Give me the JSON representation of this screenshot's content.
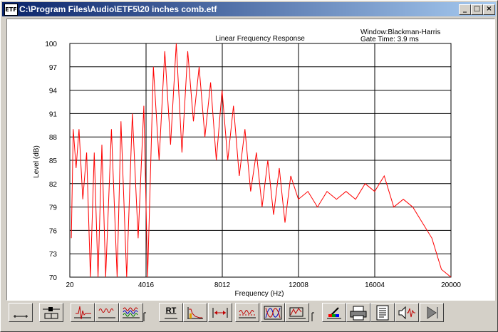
{
  "window": {
    "title": "C:\\Program Files\\Audio\\ETF5\\20 inches comb.etf",
    "app_icon": "ETF",
    "controls": {
      "minimize": "_",
      "maximize": "□",
      "close": "×"
    }
  },
  "chart": {
    "title": "Linear Frequency Response",
    "window_info": "Window:Blackman-Harris",
    "gate_info": "Gate Time: 3.9 ms",
    "xlabel": "Frequency (Hz)",
    "ylabel": "Level (dB)",
    "line_color": "#ff0000"
  },
  "chart_data": {
    "type": "line",
    "title": "Linear Frequency Response",
    "xlabel": "Frequency (Hz)",
    "ylabel": "Level (dB)",
    "xlim": [
      20,
      20000
    ],
    "ylim": [
      70,
      100
    ],
    "x_ticks": [
      "20",
      "4016",
      "8012",
      "12008",
      "16004",
      "20000"
    ],
    "y_ticks": [
      "70",
      "73",
      "76",
      "79",
      "82",
      "85",
      "88",
      "91",
      "94",
      "97",
      "100"
    ],
    "grid": true,
    "series": [
      {
        "x": [
          100,
          200,
          350,
          500,
          700,
          900,
          1100,
          1300,
          1500,
          1700,
          1900,
          2200,
          2500,
          2700,
          3000,
          3300,
          3600,
          3900,
          4100,
          4400,
          4700,
          5000,
          5300,
          5600,
          5900,
          6200,
          6500,
          6800,
          7100,
          7400,
          7700,
          8000,
          8300,
          8600,
          8900,
          9200,
          9500,
          9800,
          10100,
          10400,
          10700,
          11000,
          11300,
          11600,
          12000,
          12500,
          13000,
          13500,
          14000,
          14500,
          15000,
          15500,
          16000,
          16500,
          17000,
          17500,
          18000,
          18500,
          19000,
          19500,
          20000
        ],
        "y": [
          75,
          89,
          84,
          89,
          80,
          86,
          70,
          86,
          70,
          87,
          70,
          89,
          70,
          90,
          70,
          91,
          75,
          92,
          70,
          97,
          85,
          99,
          87,
          100,
          86,
          99,
          90,
          97,
          88,
          95,
          85,
          94,
          85,
          92,
          83,
          89,
          81,
          86,
          79,
          85,
          78,
          84,
          77,
          83,
          80,
          81,
          79,
          81,
          80,
          81,
          80,
          82,
          81,
          83,
          79,
          80,
          79,
          77,
          75,
          71,
          70
        ]
      }
    ]
  },
  "toolbar": {
    "buttons": [
      {
        "name": "impulse-view-button",
        "icon": "baseline-icon"
      },
      {
        "name": "window-settings-button",
        "icon": "slider-window-icon"
      },
      {
        "name": "impulse-response-button",
        "icon": "impulse-icon"
      },
      {
        "name": "frequency-response-button",
        "icon": "wave-icon"
      },
      {
        "name": "overlay-response-button",
        "icon": "multi-wave-icon"
      },
      {
        "name": "rt-button",
        "label": "RT",
        "icon": "rt-text-icon"
      },
      {
        "name": "waterfall-button",
        "icon": "decay-icon"
      },
      {
        "name": "delay-button",
        "icon": "range-arrows-icon"
      },
      {
        "name": "response-compare-button",
        "icon": "comb-wave-icon"
      },
      {
        "name": "phase-button",
        "icon": "phase-icon"
      },
      {
        "name": "filter-button",
        "icon": "filter-icon"
      },
      {
        "name": "color-button",
        "icon": "color-pen-icon"
      },
      {
        "name": "print-button",
        "icon": "printer-icon"
      },
      {
        "name": "report-button",
        "icon": "document-icon"
      },
      {
        "name": "speaker-button",
        "icon": "speaker-icon"
      },
      {
        "name": "play-button",
        "icon": "play-icon"
      }
    ]
  }
}
